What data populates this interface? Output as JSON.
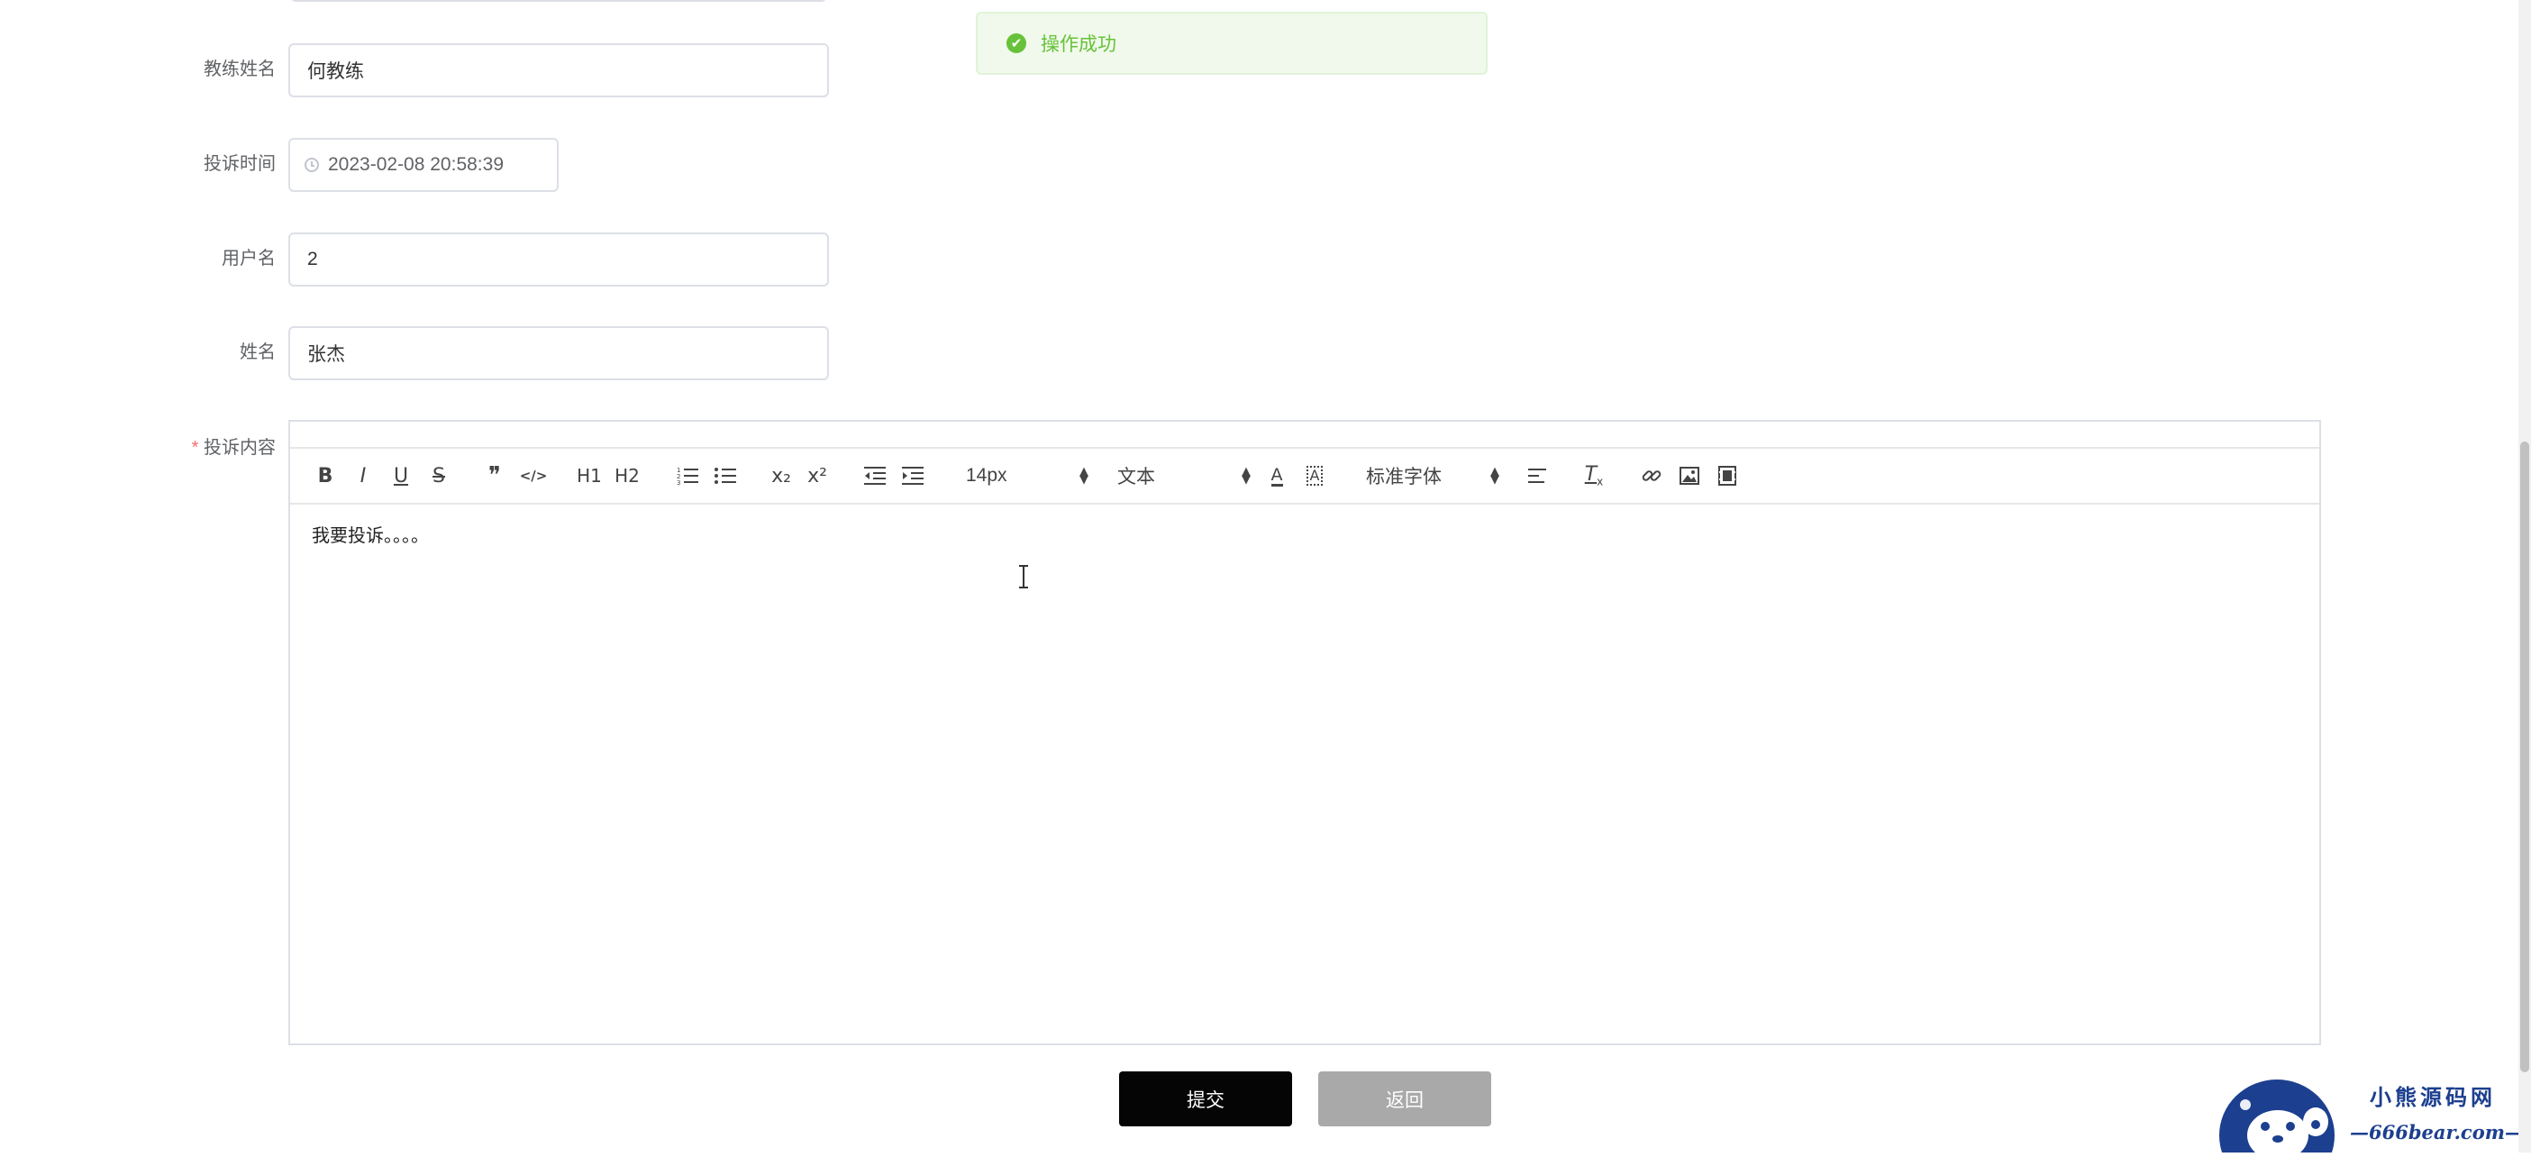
{
  "form": {
    "coach_name": {
      "label": "教练姓名",
      "value": "何教练"
    },
    "complaint_time": {
      "label": "投诉时间",
      "value": "2023-02-08 20:58:39"
    },
    "username": {
      "label": "用户名",
      "value": "2"
    },
    "real_name": {
      "label": "姓名",
      "value": "张杰"
    },
    "complaint_content": {
      "label": "投诉内容",
      "required_mark": "*",
      "text": "我要投诉。。。。"
    }
  },
  "toast": {
    "message": "操作成功",
    "icon": "check-circle-icon",
    "color": "#67c23a"
  },
  "toolbar": {
    "bold": "B",
    "italic": "I",
    "underline": "U",
    "strike": "S",
    "blockquote": "❞",
    "code": "</>",
    "h1": "H1",
    "h2": "H2",
    "ordered_list": "ordered-list-icon",
    "bullet_list": "bullet-list-icon",
    "subscript": "x₂",
    "superscript": "x²",
    "outdent": "outdent-icon",
    "indent": "indent-icon",
    "size_select": "14px",
    "header_select": "文本",
    "color": "A",
    "background": "A",
    "font_select": "标准字体",
    "align": "align-left-icon",
    "clean": "Tx",
    "link": "link-icon",
    "image": "image-icon",
    "video": "video-icon"
  },
  "buttons": {
    "submit": "提交",
    "back": "返回"
  },
  "colors": {
    "submit_bg": "#050505",
    "back_bg": "#a9a9a9",
    "toast_bg": "#f0f9eb"
  },
  "watermark": {
    "title": "小熊源码网",
    "subtitle": "—666bear.com—"
  }
}
